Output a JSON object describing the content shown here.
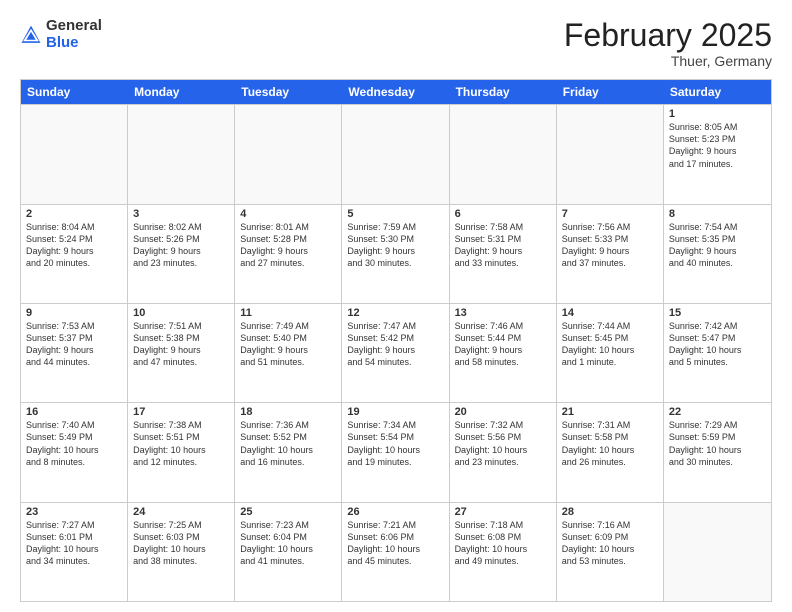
{
  "header": {
    "logo_general": "General",
    "logo_blue": "Blue",
    "month_year": "February 2025",
    "location": "Thuer, Germany"
  },
  "days_of_week": [
    "Sunday",
    "Monday",
    "Tuesday",
    "Wednesday",
    "Thursday",
    "Friday",
    "Saturday"
  ],
  "weeks": [
    [
      {
        "day": "",
        "detail": ""
      },
      {
        "day": "",
        "detail": ""
      },
      {
        "day": "",
        "detail": ""
      },
      {
        "day": "",
        "detail": ""
      },
      {
        "day": "",
        "detail": ""
      },
      {
        "day": "",
        "detail": ""
      },
      {
        "day": "1",
        "detail": "Sunrise: 8:05 AM\nSunset: 5:23 PM\nDaylight: 9 hours\nand 17 minutes."
      }
    ],
    [
      {
        "day": "2",
        "detail": "Sunrise: 8:04 AM\nSunset: 5:24 PM\nDaylight: 9 hours\nand 20 minutes."
      },
      {
        "day": "3",
        "detail": "Sunrise: 8:02 AM\nSunset: 5:26 PM\nDaylight: 9 hours\nand 23 minutes."
      },
      {
        "day": "4",
        "detail": "Sunrise: 8:01 AM\nSunset: 5:28 PM\nDaylight: 9 hours\nand 27 minutes."
      },
      {
        "day": "5",
        "detail": "Sunrise: 7:59 AM\nSunset: 5:30 PM\nDaylight: 9 hours\nand 30 minutes."
      },
      {
        "day": "6",
        "detail": "Sunrise: 7:58 AM\nSunset: 5:31 PM\nDaylight: 9 hours\nand 33 minutes."
      },
      {
        "day": "7",
        "detail": "Sunrise: 7:56 AM\nSunset: 5:33 PM\nDaylight: 9 hours\nand 37 minutes."
      },
      {
        "day": "8",
        "detail": "Sunrise: 7:54 AM\nSunset: 5:35 PM\nDaylight: 9 hours\nand 40 minutes."
      }
    ],
    [
      {
        "day": "9",
        "detail": "Sunrise: 7:53 AM\nSunset: 5:37 PM\nDaylight: 9 hours\nand 44 minutes."
      },
      {
        "day": "10",
        "detail": "Sunrise: 7:51 AM\nSunset: 5:38 PM\nDaylight: 9 hours\nand 47 minutes."
      },
      {
        "day": "11",
        "detail": "Sunrise: 7:49 AM\nSunset: 5:40 PM\nDaylight: 9 hours\nand 51 minutes."
      },
      {
        "day": "12",
        "detail": "Sunrise: 7:47 AM\nSunset: 5:42 PM\nDaylight: 9 hours\nand 54 minutes."
      },
      {
        "day": "13",
        "detail": "Sunrise: 7:46 AM\nSunset: 5:44 PM\nDaylight: 9 hours\nand 58 minutes."
      },
      {
        "day": "14",
        "detail": "Sunrise: 7:44 AM\nSunset: 5:45 PM\nDaylight: 10 hours\nand 1 minute."
      },
      {
        "day": "15",
        "detail": "Sunrise: 7:42 AM\nSunset: 5:47 PM\nDaylight: 10 hours\nand 5 minutes."
      }
    ],
    [
      {
        "day": "16",
        "detail": "Sunrise: 7:40 AM\nSunset: 5:49 PM\nDaylight: 10 hours\nand 8 minutes."
      },
      {
        "day": "17",
        "detail": "Sunrise: 7:38 AM\nSunset: 5:51 PM\nDaylight: 10 hours\nand 12 minutes."
      },
      {
        "day": "18",
        "detail": "Sunrise: 7:36 AM\nSunset: 5:52 PM\nDaylight: 10 hours\nand 16 minutes."
      },
      {
        "day": "19",
        "detail": "Sunrise: 7:34 AM\nSunset: 5:54 PM\nDaylight: 10 hours\nand 19 minutes."
      },
      {
        "day": "20",
        "detail": "Sunrise: 7:32 AM\nSunset: 5:56 PM\nDaylight: 10 hours\nand 23 minutes."
      },
      {
        "day": "21",
        "detail": "Sunrise: 7:31 AM\nSunset: 5:58 PM\nDaylight: 10 hours\nand 26 minutes."
      },
      {
        "day": "22",
        "detail": "Sunrise: 7:29 AM\nSunset: 5:59 PM\nDaylight: 10 hours\nand 30 minutes."
      }
    ],
    [
      {
        "day": "23",
        "detail": "Sunrise: 7:27 AM\nSunset: 6:01 PM\nDaylight: 10 hours\nand 34 minutes."
      },
      {
        "day": "24",
        "detail": "Sunrise: 7:25 AM\nSunset: 6:03 PM\nDaylight: 10 hours\nand 38 minutes."
      },
      {
        "day": "25",
        "detail": "Sunrise: 7:23 AM\nSunset: 6:04 PM\nDaylight: 10 hours\nand 41 minutes."
      },
      {
        "day": "26",
        "detail": "Sunrise: 7:21 AM\nSunset: 6:06 PM\nDaylight: 10 hours\nand 45 minutes."
      },
      {
        "day": "27",
        "detail": "Sunrise: 7:18 AM\nSunset: 6:08 PM\nDaylight: 10 hours\nand 49 minutes."
      },
      {
        "day": "28",
        "detail": "Sunrise: 7:16 AM\nSunset: 6:09 PM\nDaylight: 10 hours\nand 53 minutes."
      },
      {
        "day": "",
        "detail": ""
      }
    ]
  ]
}
